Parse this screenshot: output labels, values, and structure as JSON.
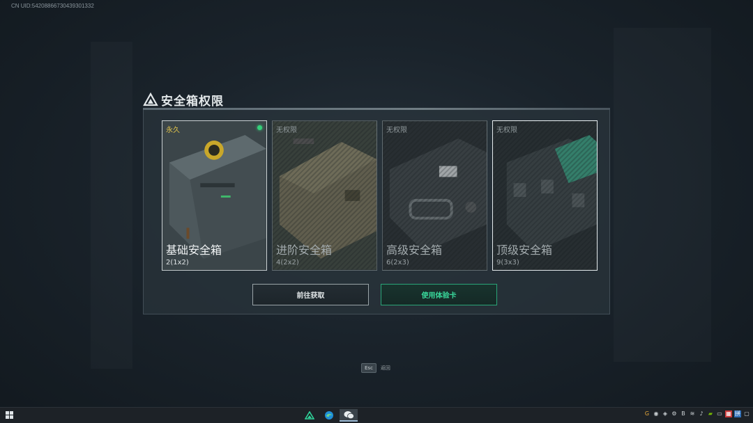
{
  "uid_text": "CN UID:54208866730439301332",
  "dialog": {
    "title": "安全箱权限",
    "cards": [
      {
        "name": "基础安全箱",
        "size": "2(1x2)",
        "status": "永久",
        "owned": true
      },
      {
        "name": "进阶安全箱",
        "size": "4(2x2)",
        "status": "无权限",
        "owned": false
      },
      {
        "name": "高级安全箱",
        "size": "6(2x3)",
        "status": "无权限",
        "owned": false
      },
      {
        "name": "顶级安全箱",
        "size": "9(3x3)",
        "status": "无权限",
        "owned": false
      }
    ],
    "buttons": {
      "go_obtain": "前往获取",
      "use_trial_card": "使用体验卡"
    }
  },
  "esc_hint": {
    "key": "Esc",
    "label": "返回"
  },
  "colors": {
    "accent_green": "#39d69a",
    "owned_yellow": "#e0c34a",
    "active_dot": "#35d07a"
  },
  "taskbar": {
    "apps": [
      "game-icon",
      "edge-icon",
      "wechat-icon"
    ],
    "tray_icons": [
      "g-icon",
      "wechat-icon",
      "cube-icon",
      "settings-icon",
      "b-icon",
      "wifi-icon",
      "volume-icon",
      "nvidia-icon",
      "battery-icon",
      "calendar-icon",
      "input-icon",
      "chat-icon"
    ]
  }
}
